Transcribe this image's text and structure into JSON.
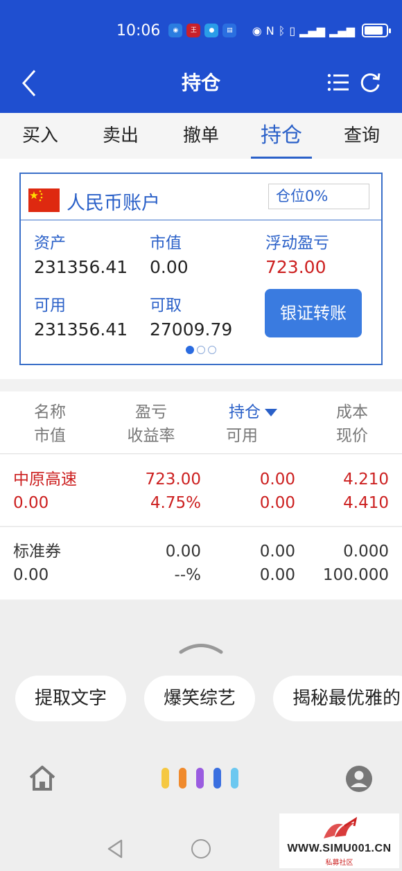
{
  "status_bar": {
    "time": "10:06",
    "indicators": [
      "eye-icon",
      "nfc-icon",
      "bluetooth-icon",
      "vibrate-icon",
      "5g-signal-icon",
      "4g-signal-icon",
      "battery-icon"
    ]
  },
  "header": {
    "title": "持仓"
  },
  "tabs": [
    {
      "label": "买入"
    },
    {
      "label": "卖出"
    },
    {
      "label": "撤单"
    },
    {
      "label": "持仓",
      "active": true
    },
    {
      "label": "查询"
    }
  ],
  "account": {
    "name": "人民币账户",
    "position_badge": "仓位0%",
    "assets_label": "资产",
    "assets_value": "231356.41",
    "market_value_label": "市值",
    "market_value_value": "0.00",
    "floating_pl_label": "浮动盈亏",
    "floating_pl_value": "723.00",
    "available_label": "可用",
    "available_value": "231356.41",
    "withdrawable_label": "可取",
    "withdrawable_value": "27009.79",
    "transfer_button": "银证转账",
    "page_indicator": {
      "current": 1,
      "total": 3
    }
  },
  "table": {
    "headers": {
      "col1_top": "名称",
      "col1_bottom": "市值",
      "col2_top": "盈亏",
      "col2_bottom": "收益率",
      "col3_top": "持仓",
      "col3_bottom": "可用",
      "col4_top": "成本",
      "col4_bottom": "现价"
    },
    "rows": [
      {
        "name": "中原高速",
        "market_value": "0.00",
        "pl": "723.00",
        "return_rate": "4.75%",
        "holding": "0.00",
        "available": "0.00",
        "cost": "4.210",
        "price": "4.410"
      },
      {
        "name": "标准券",
        "market_value": "0.00",
        "pl": "0.00",
        "return_rate": "--%",
        "holding": "0.00",
        "available": "0.00",
        "cost": "0.000",
        "price": "100.000"
      }
    ]
  },
  "suggestions": [
    "提取文字",
    "爆笑综艺",
    "揭秘最优雅的"
  ],
  "assistant_bar_colors": [
    "#f5c842",
    "#f08a2c",
    "#9a5ce0",
    "#3a6fe0",
    "#6cc8f0"
  ],
  "watermark": {
    "url": "WWW.SIMU001.CN",
    "subtitle": "私募社区"
  }
}
